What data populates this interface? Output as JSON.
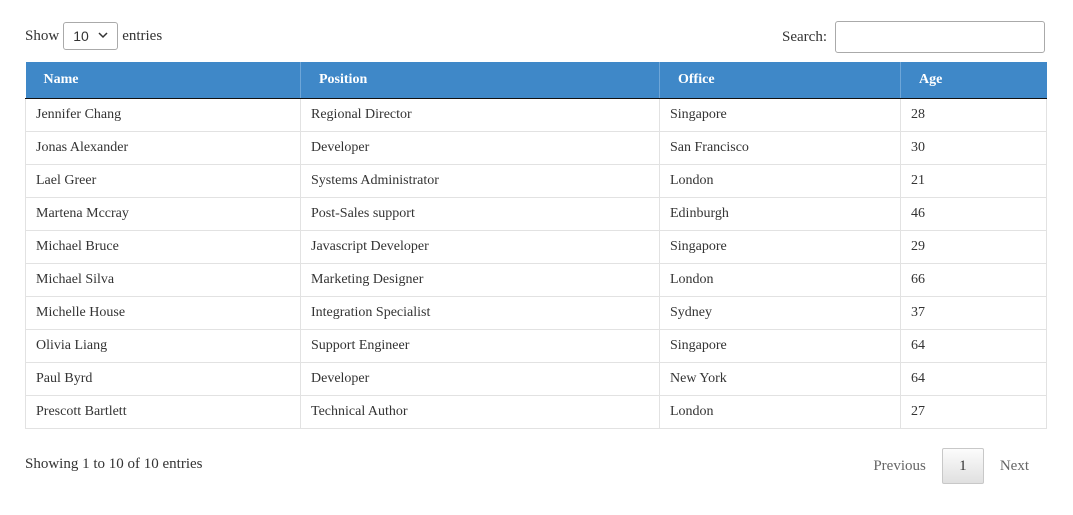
{
  "length_control": {
    "show_label": "Show",
    "selected": "10",
    "entries_label": "entries"
  },
  "search": {
    "label": "Search:",
    "value": "",
    "placeholder": ""
  },
  "table": {
    "header_bg": "#3f88c8",
    "columns": [
      "Name",
      "Position",
      "Office",
      "Age"
    ],
    "rows": [
      [
        "Jennifer Chang",
        "Regional Director",
        "Singapore",
        "28"
      ],
      [
        "Jonas Alexander",
        "Developer",
        "San Francisco",
        "30"
      ],
      [
        "Lael Greer",
        "Systems Administrator",
        "London",
        "21"
      ],
      [
        "Martena Mccray",
        "Post-Sales support",
        "Edinburgh",
        "46"
      ],
      [
        "Michael Bruce",
        "Javascript Developer",
        "Singapore",
        "29"
      ],
      [
        "Michael Silva",
        "Marketing Designer",
        "London",
        "66"
      ],
      [
        "Michelle House",
        "Integration Specialist",
        "Sydney",
        "37"
      ],
      [
        "Olivia Liang",
        "Support Engineer",
        "Singapore",
        "64"
      ],
      [
        "Paul Byrd",
        "Developer",
        "New York",
        "64"
      ],
      [
        "Prescott Bartlett",
        "Technical Author",
        "London",
        "27"
      ]
    ]
  },
  "footer": {
    "info": "Showing 1 to 10 of 10 entries",
    "previous_label": "Previous",
    "current_page": "1",
    "next_label": "Next"
  }
}
